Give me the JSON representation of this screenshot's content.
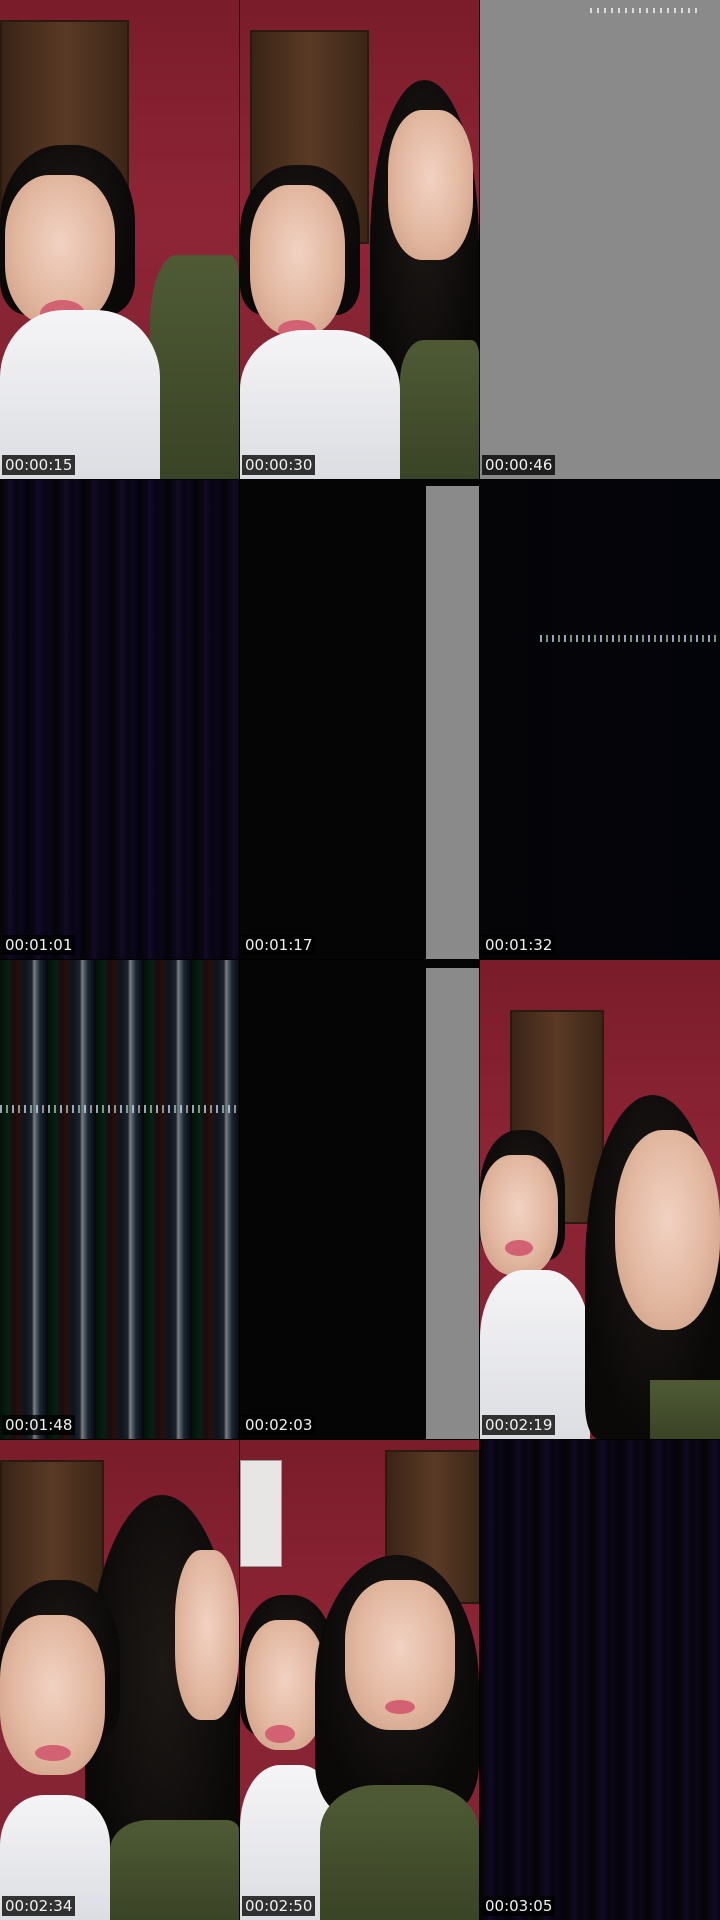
{
  "tiles": [
    {
      "timestamp": "00:00:15"
    },
    {
      "timestamp": "00:00:30"
    },
    {
      "timestamp": "00:00:46"
    },
    {
      "timestamp": "00:01:01"
    },
    {
      "timestamp": "00:01:17"
    },
    {
      "timestamp": "00:01:32"
    },
    {
      "timestamp": "00:01:48"
    },
    {
      "timestamp": "00:02:03"
    },
    {
      "timestamp": "00:02:19"
    },
    {
      "timestamp": "00:02:34"
    },
    {
      "timestamp": "00:02:50"
    },
    {
      "timestamp": "00:03:05"
    }
  ]
}
